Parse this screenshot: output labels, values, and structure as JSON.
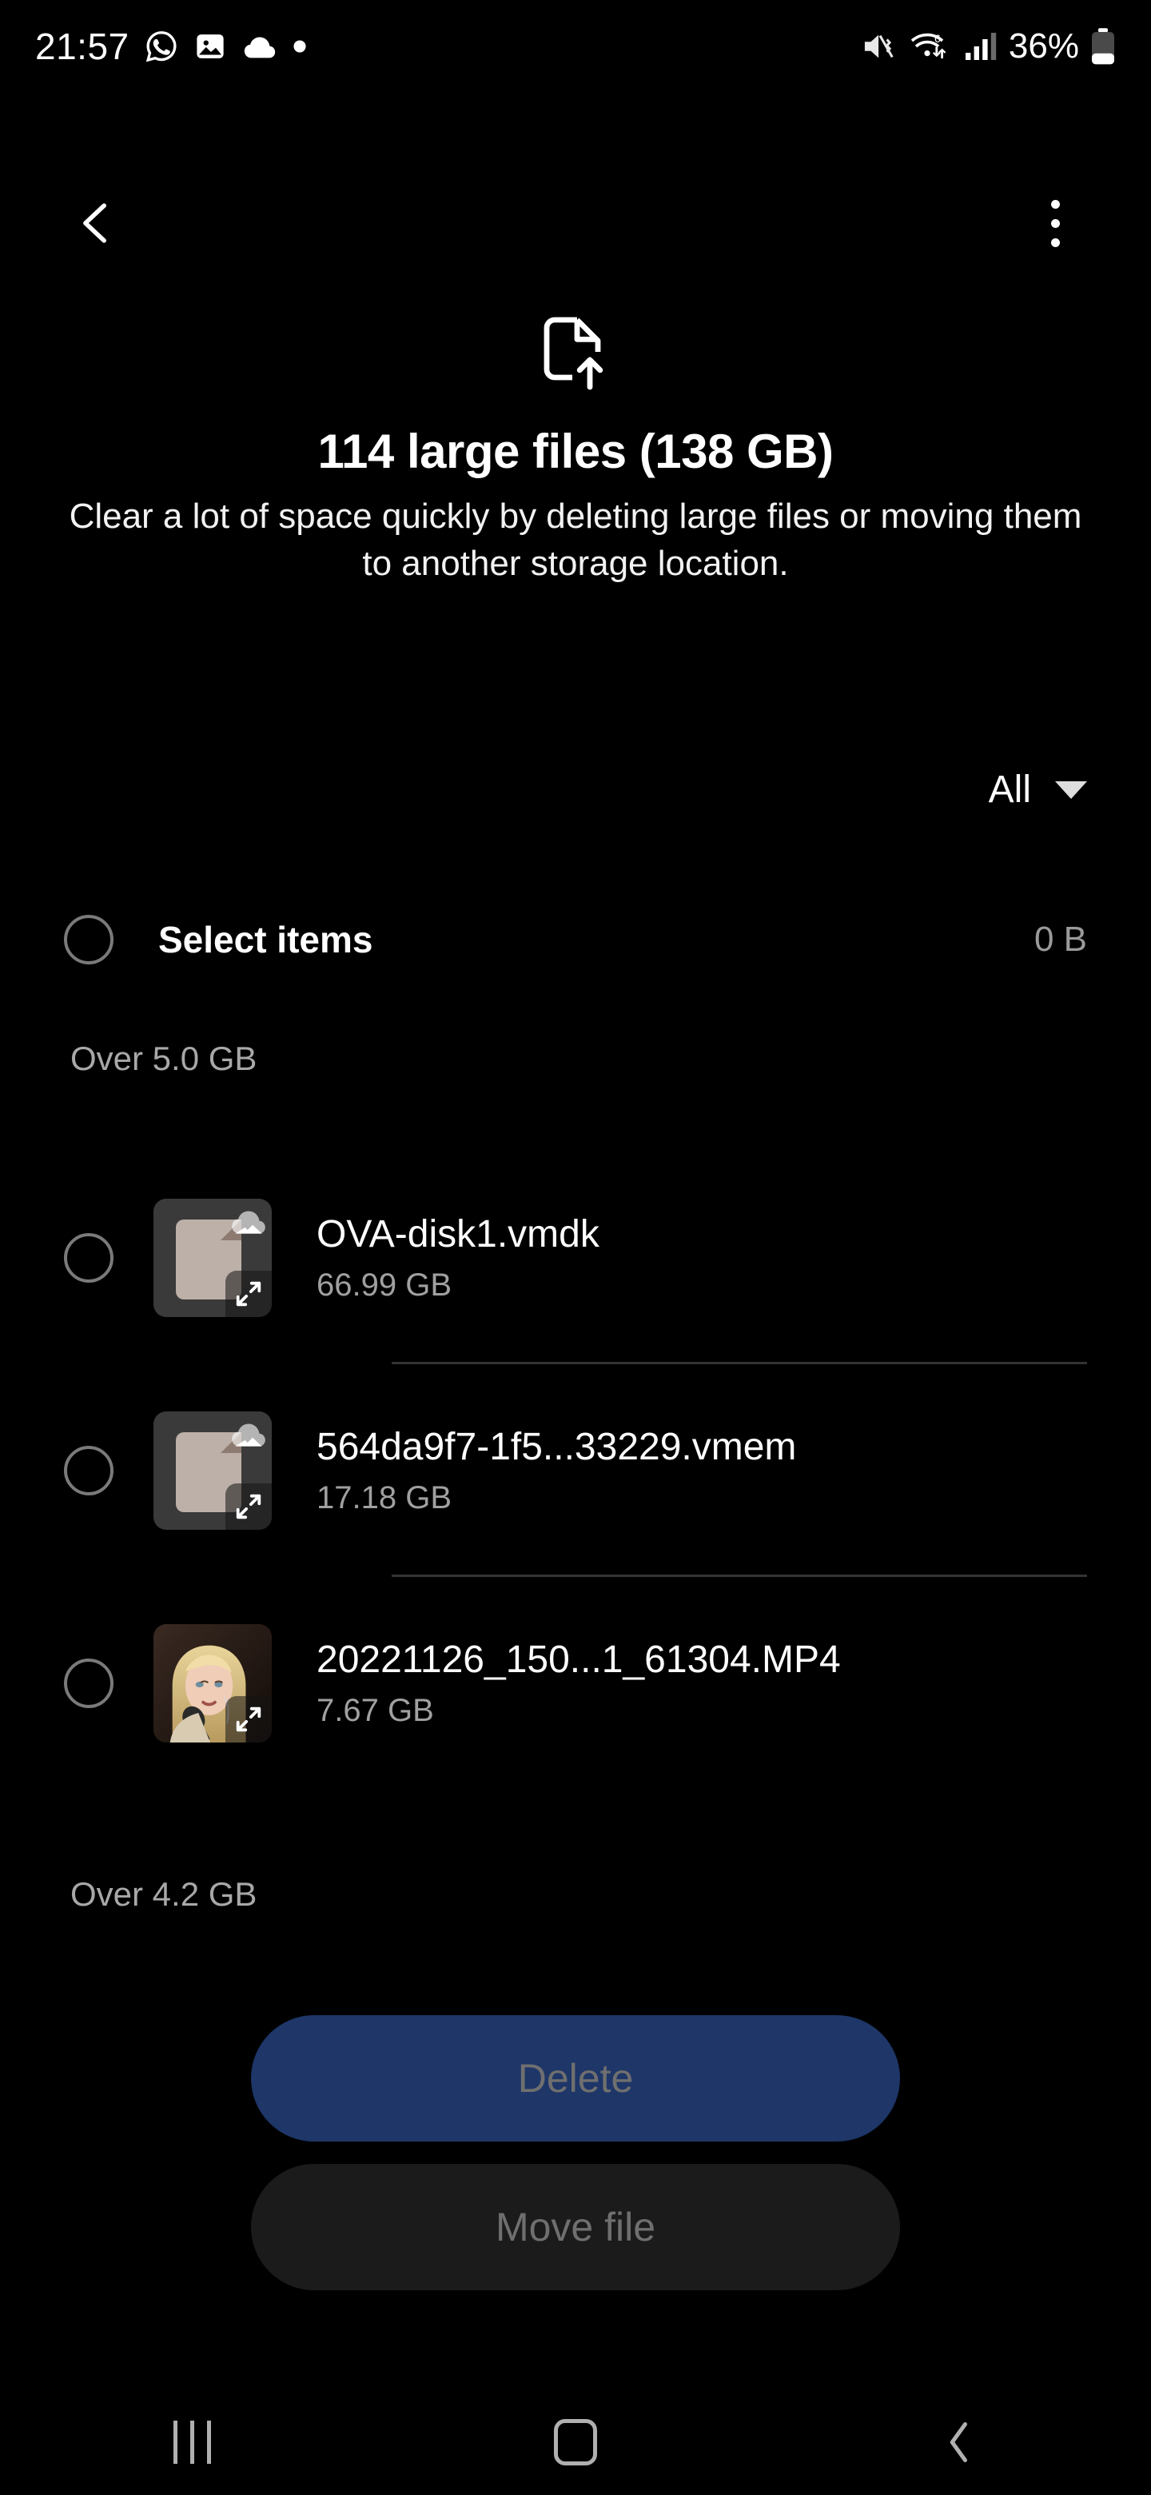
{
  "status_bar": {
    "time": "21:57",
    "left_icons": [
      "whatsapp-icon",
      "image-icon",
      "cloud-icon",
      "dot-icon"
    ],
    "right_icons": [
      "mute-vibrate-icon",
      "wifi6-icon",
      "signal-bars-icon",
      "battery-icon"
    ],
    "battery_percent": "36%",
    "wifi_generation": "6"
  },
  "top_nav": {
    "back_icon": "back-chevron-icon",
    "overflow_icon": "more-options-icon"
  },
  "header": {
    "icon": "file-upload-icon",
    "title": "114 large files (138 GB)",
    "subtitle": "Clear a lot of space quickly by deleting large files or moving them to another storage location."
  },
  "filter": {
    "label": "All",
    "caret_icon": "chevron-down-icon"
  },
  "select_bar": {
    "label": "Select items",
    "selected_size": "0 B",
    "checkbox_state": "unchecked"
  },
  "sections": [
    {
      "header": "Over 5.0 GB"
    },
    {
      "header": "Over 4.2 GB"
    }
  ],
  "files": [
    {
      "name": "OVA-disk1.vmdk",
      "size": "66.99 GB",
      "thumb_type": "generic-file",
      "badge_icon": "cloud-icon",
      "expand_icon": "expand-icon",
      "checkbox_state": "unchecked"
    },
    {
      "name": "564da9f7-1f5...33229.vmem",
      "size": "17.18 GB",
      "thumb_type": "generic-file",
      "badge_icon": "cloud-icon",
      "expand_icon": "expand-icon",
      "checkbox_state": "unchecked"
    },
    {
      "name": "20221126_150...1_61304.MP4",
      "size": "7.67 GB",
      "thumb_type": "photo",
      "badge_icon": "",
      "expand_icon": "expand-icon",
      "checkbox_state": "unchecked"
    }
  ],
  "actions": {
    "delete_label": "Delete",
    "move_label": "Move file",
    "delete_bg": "#1e3668",
    "move_bg": "#1b1b1b",
    "disabled_text": "#6f6f6f"
  },
  "bottom_nav": {
    "recents_icon": "recents-icon",
    "home_icon": "home-icon",
    "back_icon": "back-icon"
  }
}
